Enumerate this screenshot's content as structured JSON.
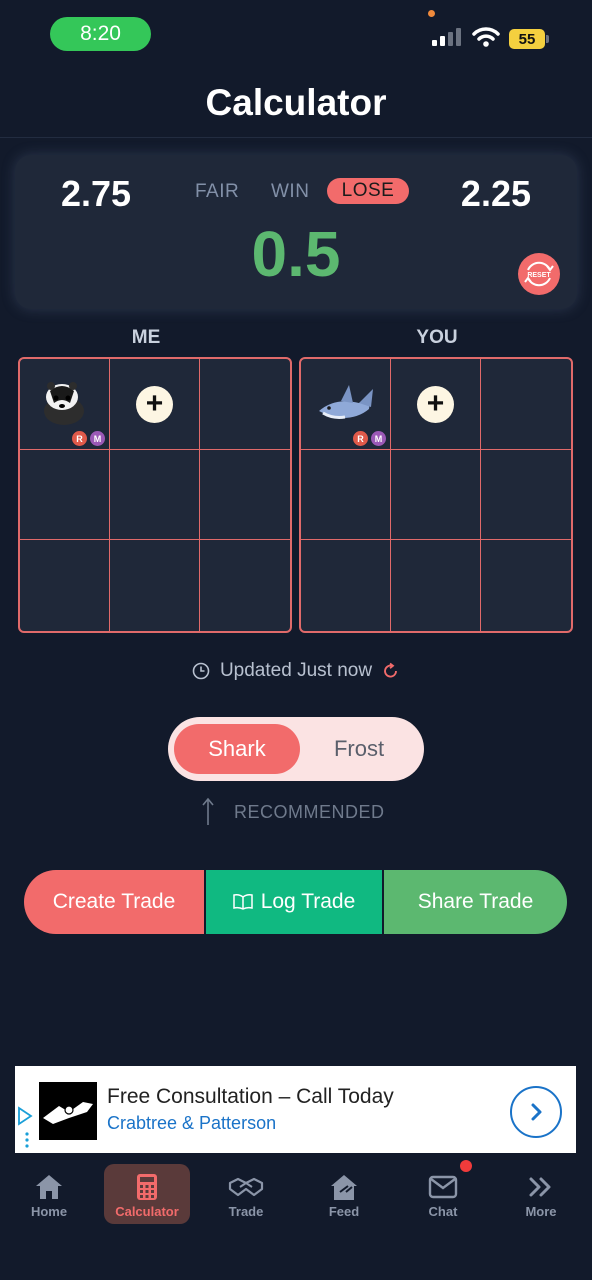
{
  "status_bar": {
    "time": "8:20",
    "battery": "55"
  },
  "header": {
    "title": "Calculator"
  },
  "result": {
    "left_value": "2.75",
    "right_value": "2.25",
    "fair_label": "FAIR",
    "win_label": "WIN",
    "lose_label": "LOSE",
    "difference": "0.5",
    "reset_label": "RESET",
    "difference_color": "#5cb870"
  },
  "grids": {
    "me_label": "ME",
    "you_label": "YOU",
    "me_items": [
      {
        "pet": "badger",
        "badges": [
          "R",
          "M"
        ]
      }
    ],
    "you_items": [
      {
        "pet": "shark",
        "badges": [
          "R",
          "M"
        ]
      }
    ]
  },
  "updated": {
    "text": "Updated Just now"
  },
  "toggle": {
    "option_a": "Shark",
    "option_b": "Frost",
    "selected": "Shark",
    "hint": "RECOMMENDED"
  },
  "actions": {
    "create": "Create Trade",
    "log": "Log Trade",
    "share": "Share Trade"
  },
  "ad": {
    "title": "Free Consultation – Call Today",
    "subtitle": "Crabtree & Patterson"
  },
  "tabs": [
    {
      "label": "Home",
      "icon": "home-icon"
    },
    {
      "label": "Calculator",
      "icon": "calculator-icon",
      "active": true
    },
    {
      "label": "Trade",
      "icon": "handshake-icon"
    },
    {
      "label": "Feed",
      "icon": "feed-house-icon"
    },
    {
      "label": "Chat",
      "icon": "mail-icon",
      "notification": true
    },
    {
      "label": "More",
      "icon": "double-chevron-icon"
    }
  ],
  "colors": {
    "accent": "#f26b6b",
    "green": "#5cb870",
    "teal": "#10b981",
    "background": "#121a2b"
  }
}
